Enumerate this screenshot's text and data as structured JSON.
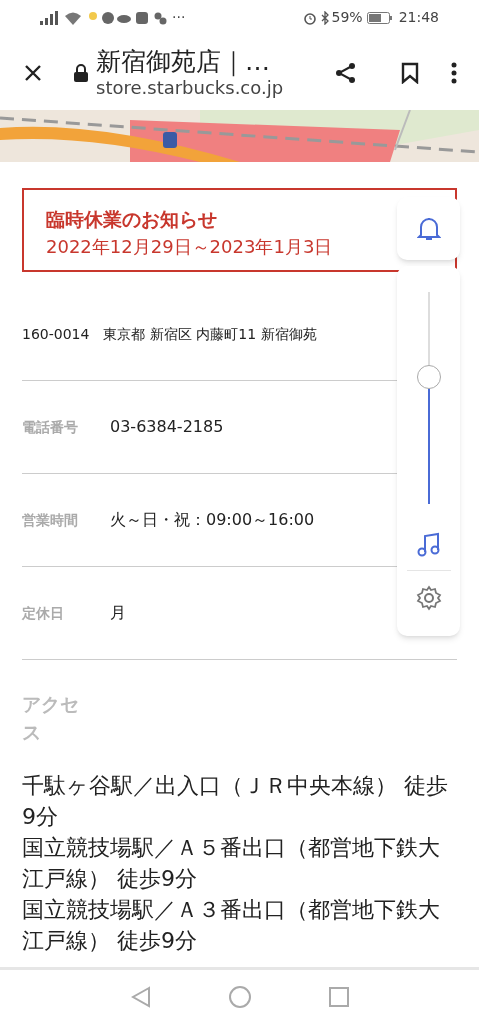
{
  "status_bar": {
    "battery": "59%",
    "time": "21:48",
    "more": "···"
  },
  "toolbar": {
    "title": "新宿御苑店｜…",
    "url": "store.starbucks.co.jp"
  },
  "notice": {
    "title": "臨時休業のお知らせ",
    "dates": "2022年12月29日～2023年1月3日"
  },
  "info_rows": [
    {
      "label": "",
      "value": "160-0014　東京都 新宿区 内藤町11 新宿御苑"
    },
    {
      "label": "電話番号",
      "value": "03-6384-2185"
    },
    {
      "label": "営業時間",
      "value": "火～日・祝：09:00～16:00"
    },
    {
      "label": "定休日",
      "value": "月"
    }
  ],
  "access": {
    "label": "アクセス",
    "lines": [
      "千駄ヶ谷駅／出入口（ＪＲ中央本線） 徒歩9分",
      "国立競技場駅／Ａ５番出口（都営地下鉄大江戸線） 徒歩9分",
      "国立競技場駅／Ａ３番出口（都営地下鉄大江戸線） 徒歩9分"
    ]
  },
  "volume_panel": {
    "level": 0.6
  }
}
